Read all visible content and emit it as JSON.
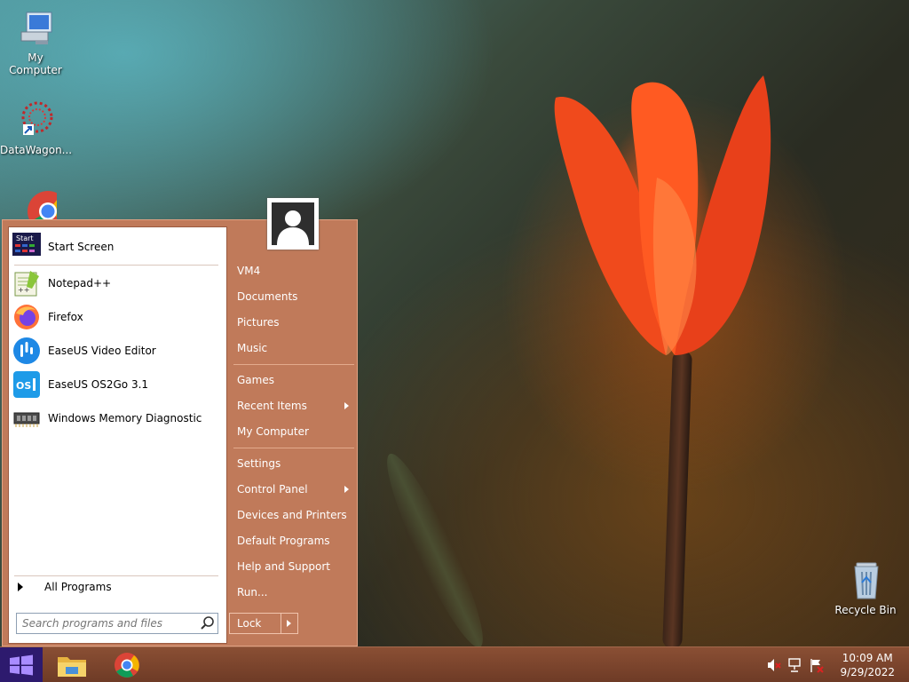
{
  "desktop": {
    "icons": [
      {
        "label": "My Computer",
        "icon": "computer-icon"
      },
      {
        "label": "DataWagon...",
        "icon": "datawagon-icon"
      },
      {
        "label": "",
        "icon": "chrome-icon"
      },
      {
        "label": "Recycle Bin",
        "icon": "recycle-bin-icon"
      }
    ]
  },
  "start_menu": {
    "pinned": [
      {
        "label": "Start Screen",
        "icon": "start-screen-icon"
      }
    ],
    "programs": [
      {
        "label": "Notepad++",
        "icon": "notepadpp-icon"
      },
      {
        "label": "Firefox",
        "icon": "firefox-icon"
      },
      {
        "label": "EaseUS Video Editor",
        "icon": "easeus-video-editor-icon"
      },
      {
        "label": "EaseUS OS2Go 3.1",
        "icon": "easeus-os2go-icon"
      },
      {
        "label": "Windows Memory Diagnostic",
        "icon": "memory-diagnostic-icon"
      }
    ],
    "start_screen_badge": "Start",
    "os2go_badge": "OS",
    "all_programs": "All Programs",
    "search_placeholder": "Search programs and files",
    "right": {
      "vm4": "VM4",
      "documents": "Documents",
      "pictures": "Pictures",
      "music": "Music",
      "games": "Games",
      "recent_items": "Recent Items",
      "my_computer": "My Computer",
      "settings": "Settings",
      "control_panel": "Control Panel",
      "devices_printers": "Devices and Printers",
      "default_programs": "Default Programs",
      "help_support": "Help and Support",
      "run": "Run..."
    },
    "lock": "Lock"
  },
  "taskbar": {
    "apps": [
      "file-explorer-icon",
      "chrome-icon"
    ],
    "time": "10:09 AM",
    "date": "9/29/2022"
  },
  "colors": {
    "menu_bg": "#c07a5a",
    "taskbar_bg": "#7a4530",
    "start_button": "#2d1a6e"
  }
}
